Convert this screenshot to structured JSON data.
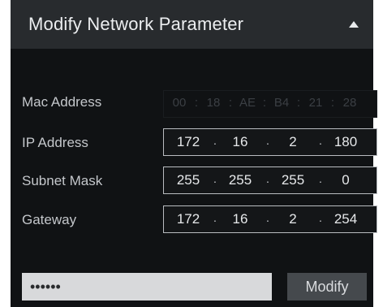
{
  "header": {
    "title": "Modify Network Parameter",
    "collapse_icon": "collapse-up-triangle-icon"
  },
  "fields": {
    "mac": {
      "label": "Mac Address",
      "octets": [
        "00",
        "18",
        "AE",
        "B4",
        "21",
        "28"
      ],
      "separator": ":",
      "enabled": false
    },
    "ip": {
      "label": "IP Address",
      "octets": [
        "172",
        "16",
        "2",
        "180"
      ],
      "separator": "."
    },
    "subnet": {
      "label": "Subnet Mask",
      "octets": [
        "255",
        "255",
        "255",
        "0"
      ],
      "separator": "."
    },
    "gateway": {
      "label": "Gateway",
      "octets": [
        "172",
        "16",
        "2",
        "254"
      ],
      "separator": "."
    }
  },
  "password": {
    "value": "••••••"
  },
  "actions": {
    "modify_label": "Modify"
  },
  "colors": {
    "panel_bg": "#101214",
    "header_bg": "#282b2e",
    "field_border": "#b9bcc0",
    "input_bg": "#d8d9db",
    "button_bg": "#45494d"
  }
}
